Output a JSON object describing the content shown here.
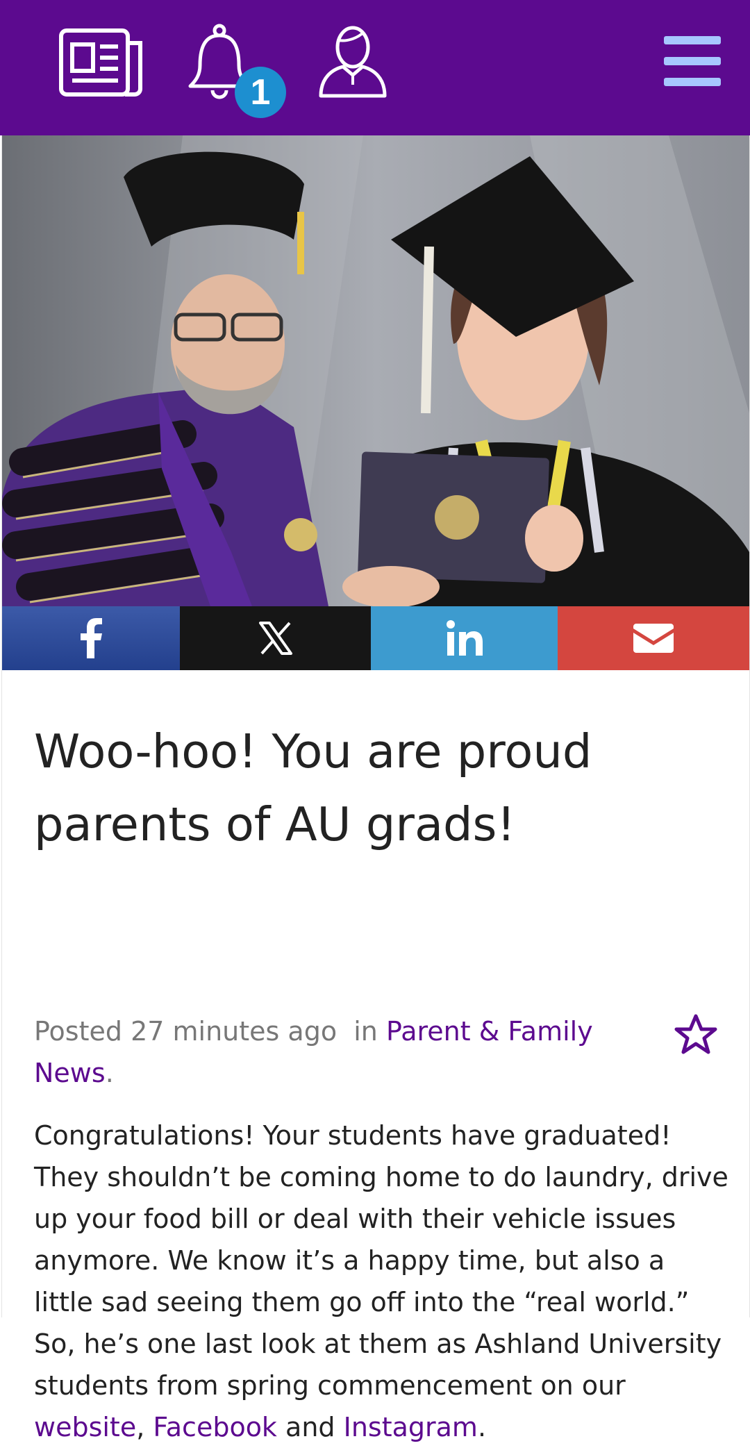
{
  "header": {
    "notification_count": "1",
    "colors": {
      "bar": "#5c0a8f",
      "menu": "#a7c7ff",
      "badge": "#1d8fd0"
    },
    "icons": [
      "newspaper-icon",
      "bell-icon",
      "user-icon",
      "hamburger-menu-icon"
    ]
  },
  "share": {
    "icons": [
      "facebook-icon",
      "x-icon",
      "linkedin-icon",
      "email-icon"
    ],
    "colors": {
      "facebook": "#2f4e9c",
      "x": "#161616",
      "linkedin": "#3d9bcf",
      "email": "#d4463f"
    }
  },
  "article": {
    "title": "Woo-hoo! You are proud parents of AU grads!",
    "posted": "Posted 27 minutes ago",
    "in_word": "in",
    "category": "Parent & Family News",
    "period": ".",
    "body_main": "Congratulations! Your students have graduated! They shouldn’t be coming home to do laundry, drive up your food bill or deal with their vehicle issues anymore. We know it’s a happy time, but also a little sad seeing them go off into the “real world.” So, he’s one last look at them as Ashland University students from spring commencement on our ",
    "link_website": "website",
    "comma": ", ",
    "link_facebook": "Facebook",
    "and_word": " and ",
    "link_instagram": "Instagram",
    "end_period": ".",
    "accent_color": "#5c0a8f"
  }
}
